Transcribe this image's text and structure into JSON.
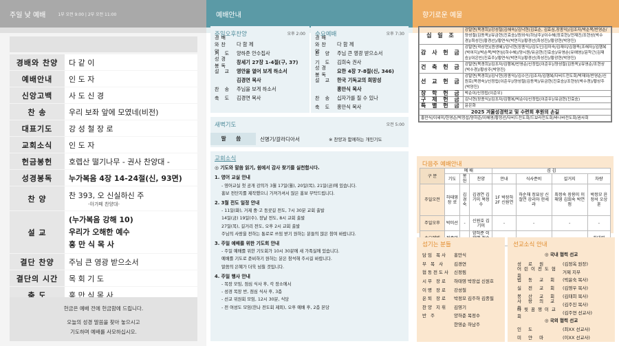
{
  "col1": {
    "header": "주일 낮 예배",
    "times": "1부 오전 9:00 | 2부 오전 11:00",
    "rows": [
      {
        "label": "경배와 찬양",
        "value": "다 같 이"
      },
      {
        "label": "예배안내",
        "value": "인 도 자"
      },
      {
        "label": "신앙고백",
        "value": "사 도 신 경"
      },
      {
        "label": "찬 송",
        "value": "우리 보좌 앞에 모였네(비전)"
      },
      {
        "label": "대표기도",
        "value": "강 성 철 장 로"
      },
      {
        "label": "교회소식",
        "value": "인 도 자"
      },
      {
        "label": "헌금봉헌",
        "value": "호렙산 떨기나무 - 권사 찬양대 -"
      },
      {
        "label": "성경봉독",
        "value": "누가복음 4장 14-24절(신, 93면)"
      }
    ],
    "hymn": {
      "label": "찬 양",
      "value": "찬 393, 오 신실하신 주",
      "sub": "-아가페 찬양대-"
    },
    "sermon": {
      "label": "설 교",
      "line1": "(누가복음 강해 10)",
      "line2": "우리가 오해한 예수",
      "line3": "홍 만 식 목 사"
    },
    "rows2": [
      {
        "label": "결단 찬양",
        "value": "주님 큰 영광 받으소서"
      },
      {
        "label": "결단의 시간",
        "value": "목 회 기 도"
      },
      {
        "label": "축 도",
        "value": "홍 만 식 목 사"
      }
    ],
    "note1": "헌금은 예배 전에 헌금함에 드립니다.",
    "note2": "오늘의 성경 말씀을 찾아 놓으시고",
    "note3": "기도하며 예배를 사모하십시오."
  },
  "col2": {
    "header": "예배안내",
    "sunday_pm": {
      "title": "주일오후찬양",
      "time": "오후 2:00",
      "rows": [
        {
          "k": "경배와찬양",
          "v": "다 함 께"
        },
        {
          "k": "기 도",
          "v": "양하준 안수집사"
        },
        {
          "k": "성경봉독",
          "v": "창세기 27장 1-4절(구, 37)"
        },
        {
          "k": "설 교",
          "v": "영안을 열어 보게 하소서"
        },
        {
          "k": "",
          "v": "김경연 목사"
        },
        {
          "k": "찬 송",
          "v": "주님을 보게 하소서"
        },
        {
          "k": "축 도",
          "v": "김경연 목사"
        }
      ]
    },
    "wed": {
      "title": "수요예배",
      "time": "오후 7:30",
      "rows": [
        {
          "k": "경배와찬양",
          "v": "다 함 께"
        },
        {
          "k": "찬 양",
          "v": "주님 큰 영광 받으소서"
        },
        {
          "k": "기 도",
          "v": "김희숙 권사"
        },
        {
          "k": "성경봉독",
          "v": "요한 4장 7-8절(신, 346)"
        },
        {
          "k": "설 교",
          "v": "한국 기독교의 희망성"
        },
        {
          "k": "",
          "v": "홍만식 목사"
        },
        {
          "k": "찬 송",
          "v": "십자가를 질 수 있나"
        },
        {
          "k": "축 도",
          "v": "홍만식 목사"
        }
      ]
    },
    "dawn": {
      "title": "새벽기도",
      "time": "오전 5:00",
      "label": "말 씀",
      "value": "신명기/갈라디아서",
      "note": "※ 찬양과 함께하는 개인기도"
    },
    "news": {
      "title": "교회소식",
      "intro": "◎ 기도와 말씀 읽기, 쉼에서 감사 찾기를 실천합시다.",
      "items": [
        {
          "h": "1. 영어 교실 안내",
          "lines": [
            "- 영어교실 첫 공개 강의가 3월 17일(월), 20일(목), 21일(금)에 있습니다.",
            "  홍보 전단지를 제작했으니 가져가셔서 많은 홍보 부탁드립니다."
          ]
        },
        {
          "h": "2. 3월 전도 일정 안내",
          "lines": [
            "- 11일(화), 거제 중·고 등굣길 전도, 7시 30분 교회 출발",
            "  14일(금) 19일(수), 장날 전도, 8시 교회 출발",
            "  27일(목), 길거리 전도, 오후 2시 교회 출발",
            "  주님의 사랑을 전하는 통로로 쓰임 받기 원하는 분들의 많은 참여 바랍니다."
          ]
        },
        {
          "h": "3. 주일 예배를 위한 기도회 안내",
          "lines": [
            "- 주일 예배를 위한 기도회가 10시 30분에 새 가족실에 있습니다.",
            "  예배를 기도로 준비하기 원하는 분은 참석해 주시길 바랍니다.",
            "  말씀의 은혜가 더욱 넘칠 것입니다."
          ]
        },
        {
          "h": "4. 주일 행사 안내",
          "lines": [
            "- 목장 모임, 점심 식사 후, 각 장소에서",
            "- 성경 목장 반, 점심 식사 후, 3층",
            "- 선교 위원회 모임, 12시 30분, 식당",
            "- 전 여성도 모임(한나 전도회 제외), 오후 예배 후, 2층 본당"
          ]
        }
      ]
    }
  },
  "col3": {
    "header": "향기로운 예물",
    "offerings": [
      {
        "k": "십 일 조",
        "v": "강말연(목경희)/강성철(김해숙)/김낙현(김효순, 김효심,장종익)/김조자/박순목/반영순/양성철(김동옥)/유금현(진효승)/원외식(하남주)/이수해(정호현)/전재진/조현상(박수경)/최성진(황경선)/황연식(박연지)/황경선(최성진)/황광현(박양진)"
      },
      {
        "k": "감 사 헌 금",
        "v": "강말연(곽상연)(원생혜)/김낙현(장종익)/김도인/김미숙/김재이/김형옥(조해자)/김행복(박여지)/박순목/박연심(하수해)/양시원/유금현(진효승)/유영순(유에영)/윤학근(김재승)/이은빈(진효주)/황연식(박연지)/황경선(최성진)/황광현(박양진)"
      },
      {
        "k": "건 축 헌 금",
        "v": "강말연(목경희)/김조자/김행복/반영순/신정립(이준우)/양성철(김동옥)/유영순/조현상(박수경)/황상주(박양진)"
      },
      {
        "k": "선 교 헌 금",
        "v": "강말연(목경희)/김낙현(장종익)/김수인/김조자/김행복/다비드전도회/박재와/반영순/신원호(목경숙)/신정립(이준우)/양성철(김동옥)/유금현(진효승)/조현상(박수경)/황상주(박양진)"
      },
      {
        "k": "장 학 헌 금",
        "v": "박순이/신정립(이준우)"
      },
      {
        "k": "구 제 헌 금",
        "v": "김낙현(장종익)/김조자/김행복/박순이/신정립(이준우)/유금현(진효승)"
      },
      {
        "k": "특 별 헌 금",
        "v": "윤은화"
      },
      {
        "k": "",
        "v": "2025 겨울성경학교 및 수련회 후원의 손길",
        "bold": true
      },
      {
        "k": "",
        "v": "홍만식/이세미/한영순/박정섭/양하준/이해영/황정선/다비드전도회/드보라전도회/바나바전도회/권사회"
      }
    ],
    "next": {
      "title": "다음주 예배안내",
      "top": [
        "구 분",
        "예 배",
        "섬 김"
      ],
      "cols": [
        "기도",
        "봉헌",
        "찬양",
        "안내",
        "식사준비",
        "설거지",
        "차량"
      ],
      "rows": [
        {
          "name": "주일오전",
          "cells": [
            "하태영 장 로",
            "김경숙",
            "김경연 김기미 목정수",
            "1F 박장하 2F 신원연",
            "하순채 정묘상 신철연 강리아 한세라",
            "최정숙 장용미 이해영 김희숙 박연점",
            "박정모 윤정석 오상훈"
          ]
        },
        {
          "name": "주일오후",
          "cells": [
            "박미선",
            "-",
            "신원호 김기미",
            "-",
            "-",
            "-",
            "-"
          ]
        },
        {
          "name": "수요예배",
          "cells": [
            "정종악",
            "-",
            "양하준 이한별 정순웅",
            "-",
            "-",
            "-",
            "하태영"
          ]
        }
      ]
    },
    "prayer": {
      "title": "섬기는 분들",
      "rows": [
        {
          "k": "담임 목사",
          "v": "홍만식"
        },
        {
          "k": "부 목 사",
          "v": "김경연"
        },
        {
          "k": "협동전도사",
          "v": "신정림"
        },
        {
          "k": "시무 장로",
          "v": "하태영 박장섭 신원호"
        },
        {
          "k": "이명 장로",
          "v": "강성철"
        },
        {
          "k": "은퇴 장로",
          "v": "박정모 김주하 김종필"
        },
        {
          "k": "찬양 지휘",
          "v": "김영기"
        },
        {
          "k": "반 주",
          "v": "양하준 목정수"
        },
        {
          "k": "",
          "v": "한영순 하남주"
        }
      ]
    },
    "mission": {
      "title": "선교소식 안내",
      "h1": "◎ 국내 협력 선교",
      "rows1": [
        {
          "k": "성 로 원",
          "v": "(김정옥 원장)"
        },
        {
          "k": "어린이전도협회",
          "v": "거제 지부"
        },
        {
          "k": "법 동 교 회",
          "v": "(박윤숙 목사)"
        },
        {
          "k": "실 전 교 회",
          "v": "(김영우 목사)"
        },
        {
          "k": "봉 산 교 회",
          "v": "(김태희 목사)"
        },
        {
          "k": "사 랑 의 교 회",
          "v": "(김주진 목사)"
        },
        {
          "k": "다윗꿈쟁이교회",
          "v": "(김주연 선교사)"
        }
      ],
      "h2": "◎ 국외 협력 선교",
      "rows2": [
        {
          "k": "인 도",
          "v": "(최XX 선교사)"
        },
        {
          "k": "미 얀 마",
          "v": "(이XX 선교사)"
        }
      ]
    }
  }
}
